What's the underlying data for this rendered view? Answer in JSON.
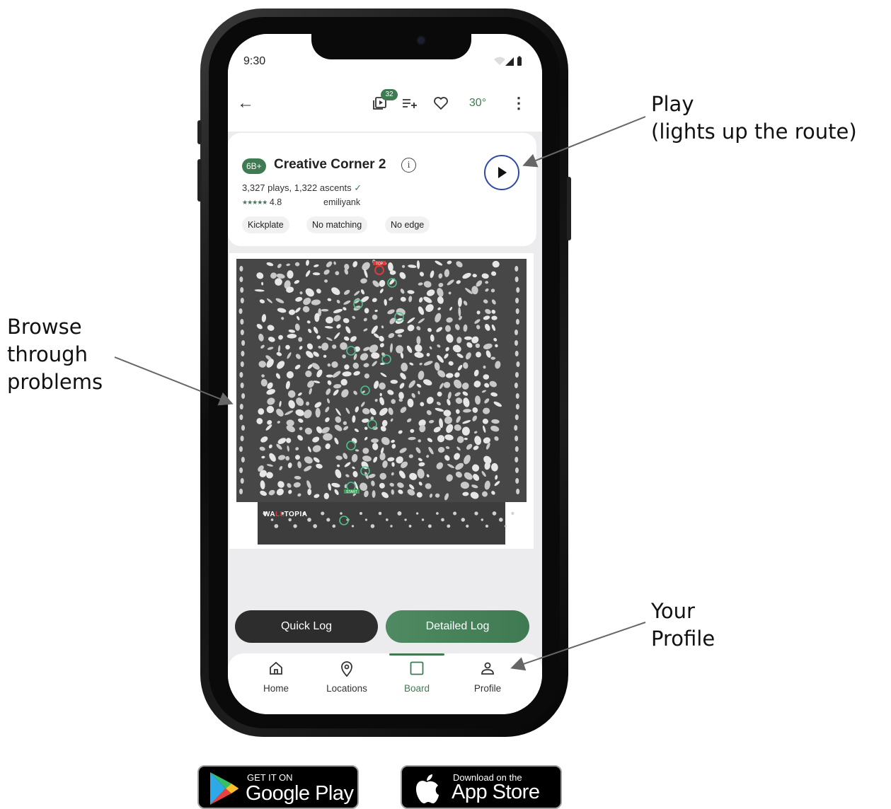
{
  "annotations": {
    "play": [
      "Play",
      "(lights up the route)"
    ],
    "browse": [
      "Browse",
      "through",
      "problems"
    ],
    "profile": [
      "Your",
      "Profile"
    ]
  },
  "status_bar": {
    "time": "9:30"
  },
  "toolbar": {
    "playlist_count": "32",
    "angle": "30°"
  },
  "problem": {
    "grade": "6B+",
    "name": "Creative Corner 2",
    "plays_ascents": "3,327 plays, 1,322 ascents",
    "stars": "★★★★★",
    "rating": "4.8",
    "setter": "emiliyank",
    "tags": [
      "Kickplate",
      "No matching",
      "No edge"
    ]
  },
  "board": {
    "top_label": "TOP",
    "start_label": "START",
    "brand_a": "WA",
    "brand_b": "LL",
    "brand_c": "TOPIA"
  },
  "actions": {
    "quick_log": "Quick Log",
    "detailed_log": "Detailed Log"
  },
  "nav": {
    "items": [
      {
        "label": "Home",
        "icon": "home-icon"
      },
      {
        "label": "Locations",
        "icon": "location-pin-icon"
      },
      {
        "label": "Board",
        "icon": "board-icon"
      },
      {
        "label": "Profile",
        "icon": "person-icon"
      }
    ],
    "active": "Board"
  },
  "stores": {
    "google": {
      "small": "GET IT ON",
      "big": "Google Play"
    },
    "apple": {
      "small": "Download on the",
      "big": "App Store"
    }
  },
  "colors": {
    "accent_green": "#3f7a52",
    "play_ring": "#2f4aa5",
    "dark_button": "#2d2d2d"
  }
}
